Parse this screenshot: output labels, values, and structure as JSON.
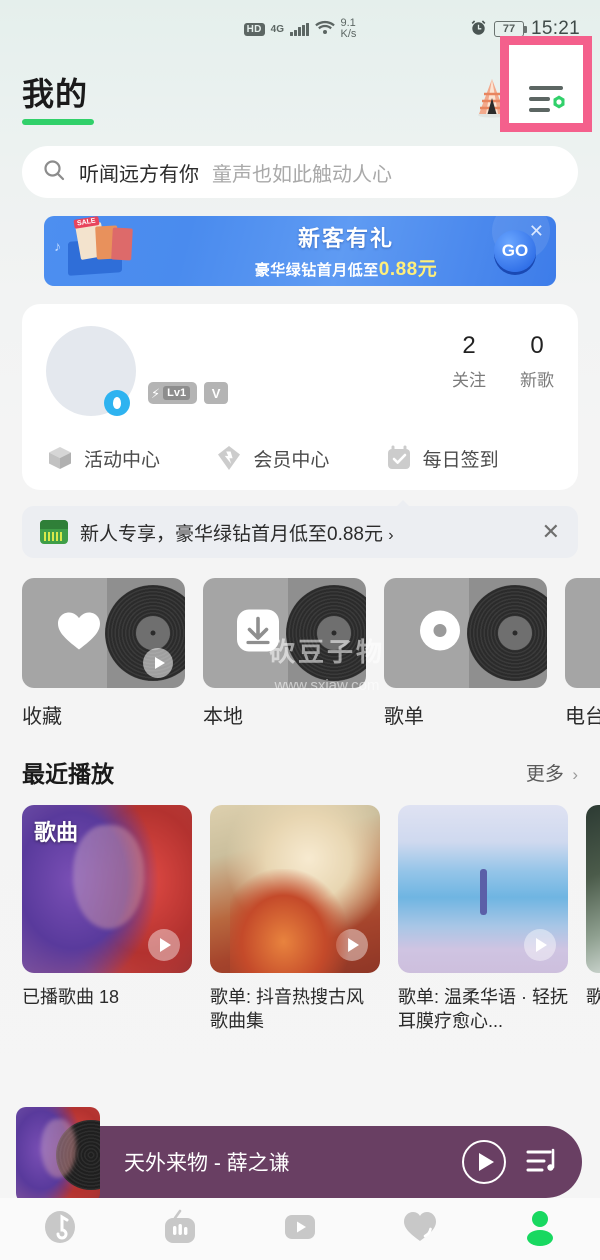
{
  "status_bar": {
    "hd": "HD",
    "network": "4G",
    "speed_value": "9.1",
    "speed_unit": "K/s",
    "alarm_icon": "alarm-clock-icon",
    "battery_level": "77",
    "time": "15:21"
  },
  "header": {
    "title": "我的",
    "tent_icon": "tent-icon",
    "mail_icon": "mail-chevron-icon",
    "menu_icon": "list-settings-icon",
    "highlight_color": "#f4608c",
    "accent_color": "#31d06a"
  },
  "search": {
    "icon": "search-icon",
    "text_primary": "听闻远方有你",
    "text_secondary": "童声也如此触动人心"
  },
  "promo_banner": {
    "headline": "新客有礼",
    "subline_prefix": "豪华绿钻首月低至",
    "amount": "0.88元",
    "go_label": "GO",
    "close_icon": "close-icon"
  },
  "profile": {
    "avatar": "user-avatar",
    "avatar_badge": "qq-penguin-badge",
    "level_badge": "Lv1",
    "v_badge": "V",
    "stats": [
      {
        "number": "2",
        "label": "关注"
      },
      {
        "number": "0",
        "label": "新歌"
      }
    ],
    "actions": [
      {
        "icon": "gift-box-icon",
        "label": "活动中心"
      },
      {
        "icon": "diamond-icon",
        "label": "会员中心"
      },
      {
        "icon": "calendar-check-icon",
        "label": "每日签到"
      }
    ]
  },
  "notice": {
    "icon": "green-diamond-icon",
    "text": "新人专享，豪华绿钻首月低至0.88元",
    "chevron": "›",
    "close_icon": "close-icon"
  },
  "quick_cards": [
    {
      "icon": "heart-icon",
      "label": "收藏"
    },
    {
      "icon": "download-icon",
      "label": "本地"
    },
    {
      "icon": "disc-icon",
      "label": "歌单"
    },
    {
      "icon": "radio-icon",
      "label": "电台"
    }
  ],
  "watermark": {
    "line1": "砍豆子物",
    "line2": "www.sxiaw.com"
  },
  "recent_section": {
    "title": "最近播放",
    "more_label": "更多",
    "items": [
      {
        "badge": "歌曲",
        "caption": "已播歌曲 18",
        "art": "art1"
      },
      {
        "badge": "",
        "caption": "歌单: 抖音热搜古风歌曲集",
        "art": "art2"
      },
      {
        "badge": "",
        "caption": "歌单: 温柔华语 · 轻抚耳膜疗愈心...",
        "art": "art3"
      },
      {
        "badge": "",
        "caption": "歌单: 精选",
        "art": "art4"
      }
    ]
  },
  "mini_player": {
    "title": "天外来物 - 薛之谦",
    "play_icon": "play-icon",
    "playlist_icon": "playlist-music-icon",
    "background_color": "#693f63"
  },
  "tab_bar": {
    "items": [
      {
        "icon": "music-note-icon",
        "active": false
      },
      {
        "icon": "radio-icon",
        "active": false
      },
      {
        "icon": "video-play-icon",
        "active": false
      },
      {
        "icon": "heart-dynamic-icon",
        "active": false
      },
      {
        "icon": "profile-person-icon",
        "active": true
      }
    ],
    "active_color": "#18d860"
  }
}
